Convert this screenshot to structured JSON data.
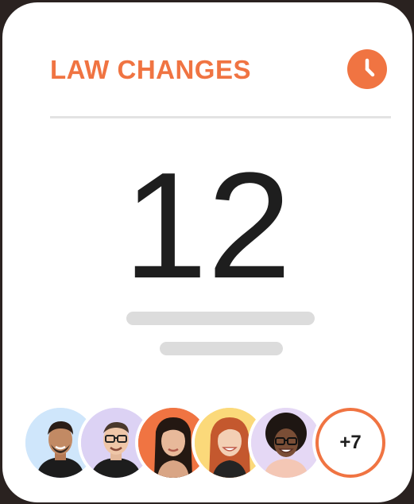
{
  "widget": {
    "title": "LAW CHANGES",
    "count": "12",
    "more_count": "+7",
    "accent_color": "#f07442",
    "header_icon": "clock-icon"
  },
  "avatars": [
    {
      "name": "avatar-1",
      "bg": "#cfe6fb"
    },
    {
      "name": "avatar-2",
      "bg": "#dcd2f4"
    },
    {
      "name": "avatar-3",
      "bg": "#f07442"
    },
    {
      "name": "avatar-4",
      "bg": "#fbd97a"
    },
    {
      "name": "avatar-5",
      "bg": "#e5d8f5"
    }
  ]
}
